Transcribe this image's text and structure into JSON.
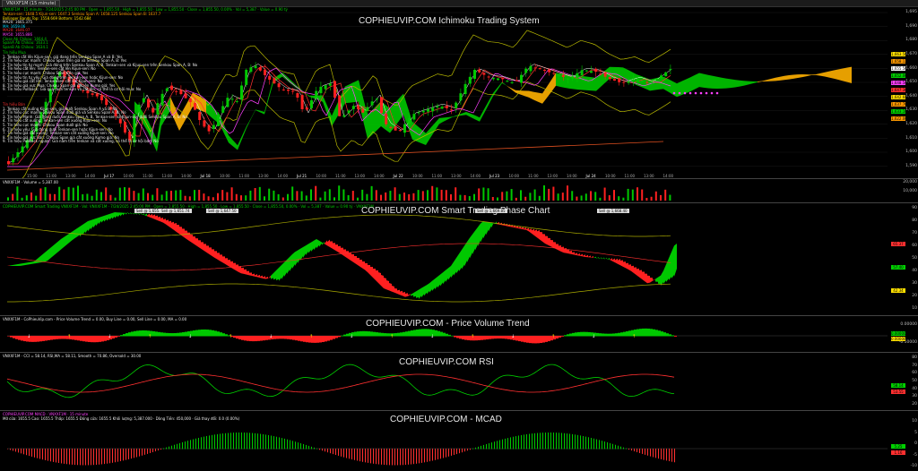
{
  "window": {
    "tab_label": "VNXXF1M (15 minute)"
  },
  "panes": {
    "ichimoku": {
      "title": "COPHIEUVIP.COM Ichimoku Trading System",
      "header": "VNXXF1M · 15 minute · 7/24/2025 2:45:00 PM · Open = 1,855.50 · High = 1,855.50 · Low = 1,855.50 · Close = 1,855.50, 0.00% · Vol = 5,387 · Value = 0.90 tỷ",
      "indicator_lines": [
        {
          "text": "Tenkan-sen: 1648.5   Kijun-sen: 1647.3   Senkou Span A: 1658.125   Senkou Span B: 1637.7",
          "color": "orange"
        },
        {
          "text": "Bollinger Bands Top: 1558.669   Bottom: 1542.684",
          "color": "yellow"
        },
        {
          "text": "MA20: 1665.375",
          "color": "white"
        },
        {
          "text": "MA: 1659.06",
          "color": "cyan"
        },
        {
          "text": "MA20: 1646.07",
          "color": "red"
        },
        {
          "text": "MA50: 1655.886",
          "color": "mag"
        },
        {
          "text": "Close Ab Chikou: 1664.4",
          "color": "green"
        },
        {
          "text": "SpanA Ab Chikou: 1633.1",
          "color": "green"
        },
        {
          "text": "SpanB Ab Chikou: 1634.1",
          "color": "green"
        }
      ],
      "buy_heading": "Tín hiệu Mua",
      "buy_signals": [
        "1. Tenkan cắt lên Kijun-sen, giá đang trên Senkou Span A và B: Yes",
        "2. Tín hiệu cực mạnh: Chikou Span trên giá và Senkou Span A, B: Yes",
        "3. Tín hiệu tín tự mạnh: Giá đóng trên Senkou Span A, B, Tenkan-sen và Kijun-sen trên Senkou Span A, B: No",
        "4. Tín hiệu cắt lên: Tenkan-sen cắt lên Kijun-sen: No",
        "5. Tín hiệu cực mạnh: Chikou Span trên giá: Yes",
        "6. Tín hiệu tín tự yếu: Giá đóng trên Tenkan-sen hoặc Kijun-sen: No",
        "7. Tín hiệu giá cắt lên: Tenkan-sen cắt lên Kijun-sen: No",
        "8. Tín hiệu giá vực Mua: Chikou Span giá cắt lên Kumo giá: Yes",
        "9. Tín hiệu Pullback: Giá quá dưới tenkan và cắt lên, có thể là cơ hội mua: No"
      ],
      "sell_heading": "Tín hiệu Bán",
      "sell_signals": [
        "1. Tenkan cắt xuống Kijun-sen, giá dưới Senkou Span A và B: No",
        "2. Tín hiệu cực mạnh: Chikou Span dưới giá và Senkou Span A, B: No",
        "3. Tín hiệu Mạnh: Giá đóng dưới Senkou Span A, B, Tenkan-sen và Kijun-sen dưới Senkou Span A, B: No",
        "4. Tín hiệu cắt xuống: Tenkan-sen cắt xuống Kijun-sen: No",
        "5. Tín hiệu cực mạnh: Chikou Span dưới giá: No",
        "6. Tín hiệu yếu: Giá đóng dưới Tenkan-sen hoặc Kijun-sen: No",
        "7. Tín hiệu giá cắt xuống: Tenkan-sen cắt xuống Kijun-sen: No",
        "8. Tín hiệu giá vực Bán: Chikou Span giá cắt xuống Kumo giá: No",
        "9. Tín hiệu Pullback ngược: Giá nằm trên tenkan và cắt xuống, có thể là cơ hội bán: No"
      ],
      "price_axis": [
        "1,695",
        "1,690",
        "1,680",
        "1,670",
        "1,660",
        "1,650",
        "1,640",
        "1,630",
        "1,620",
        "1,610",
        "1,600",
        "1,590"
      ],
      "price_tags": [
        {
          "text": "1,663.50",
          "color": "#ffe000"
        },
        {
          "text": "1,658.12",
          "color": "#ff9a00"
        },
        {
          "text": "1,655.50",
          "color": "#ffffff"
        },
        {
          "text": "1,652.00",
          "color": "#00d000"
        },
        {
          "text": "1,648.50",
          "color": "#ff40ff"
        },
        {
          "text": "1,647.30",
          "color": "#ff3030"
        },
        {
          "text": "1,642.68",
          "color": "#ffe000"
        },
        {
          "text": "1,637.70",
          "color": "#ff9a00"
        },
        {
          "text": "1,633.10",
          "color": "#00d000"
        },
        {
          "text": "1,622.00",
          "color": "#ff9a00"
        }
      ],
      "time_labels": [
        "15:00",
        "11:00",
        "13:00",
        "14:00",
        "Jul 17",
        "10:00",
        "11:00",
        "13:00",
        "14:00",
        "Jul 18",
        "10:00",
        "11:00",
        "13:00",
        "14:00",
        "Jul 21",
        "10:00",
        "11:00",
        "13:00",
        "14:00",
        "Jul 22",
        "10:00",
        "11:00",
        "13:00",
        "14:00",
        "Jul 23",
        "10:00",
        "11:00",
        "13:00",
        "14:00",
        "Jul 24",
        "10:00",
        "11:00",
        "13:00",
        "14:00"
      ]
    },
    "volume": {
      "header": "VNXXF1M · Volume = 5,387.00",
      "axis": [
        "20,000",
        "10,000"
      ]
    },
    "smart_trading": {
      "title": "COPHIEUVIP.COM Smart Trading Phase Chart",
      "header": "COPHIEUVIP.COM Smart Trading VNXXF1M · Vol: VNXXF1M · 7/24/2025 2:45:00 PM · Open = 1,855.50 · High = 1,855.50 · Low = 1,855.50 · Close = 1,855.50, 0.00% · Vol = 5,387 · Value = 0.90 tỷ · VNXXF1M",
      "signal_boxes": [
        "Sell @ 1,655.38",
        "Sell @ 1,651.74",
        "Sell @ 1,647.50",
        "Sell @ 1,669.85",
        "Sell @ 1,668.40"
      ],
      "axis": [
        "90",
        "80",
        "70",
        "60",
        "50",
        "40",
        "30",
        "20",
        "10"
      ],
      "tags": [
        {
          "text": "65.37",
          "color": "#ff3030"
        },
        {
          "text": "57.40",
          "color": "#00d000"
        },
        {
          "text": "42.34",
          "color": "#ffe000"
        }
      ]
    },
    "pvt": {
      "title": "COPHIEUVIP.COM - Price Volume Trend",
      "header": "VNXXF1M - CoPhieuVip.com - Price Volume Trend = 0.00, Buy Line = 0.00, Sell Line = 0.00, MA = 0.00",
      "axis": [
        "0.00000",
        "-0.50000"
      ],
      "tags": [
        {
          "text": "0.00000",
          "color": "#00d000"
        },
        {
          "text": "0.00000",
          "color": "#ffe000"
        }
      ]
    },
    "rsi": {
      "title": "COPHIEUVIP.COM RSI",
      "header": "VNXXF1M · CCI = 58.14, RSI,MA = 58.11, Smooth = 70.86, Oversold = 30.00",
      "axis": [
        "80",
        "70",
        "60",
        "50",
        "40",
        "30",
        "20"
      ],
      "tags": [
        {
          "text": "58.14",
          "color": "#00d000"
        },
        {
          "text": "53.55",
          "color": "#ff3030"
        }
      ]
    },
    "macd": {
      "title": "COPHIEUVIP.COM - MCAD",
      "header": "COPHIEUVIP.COM MACD · VNXXF1M · 15 minute",
      "stats": "Mở cửa: 1655.5   Cao: 1655.5   Thấp: 1655.5   Đóng cửa: 1655.5   Khối lượng: 5,387.000 · Dòng Tiền: 450,000 · Giá thay đổi: 0.0 (0.00%)",
      "axis": [
        "10",
        "5",
        "0",
        "-5",
        "-10"
      ],
      "tags": [
        {
          "text": "5.25",
          "color": "#00d000"
        },
        {
          "text": "1.16",
          "color": "#ff3030"
        }
      ]
    }
  },
  "colors": {
    "bull": "#00c800",
    "bear": "#ff2020",
    "kumo_bull": "#00c800",
    "kumo_bear": "#ffb000",
    "background": "#000000"
  }
}
